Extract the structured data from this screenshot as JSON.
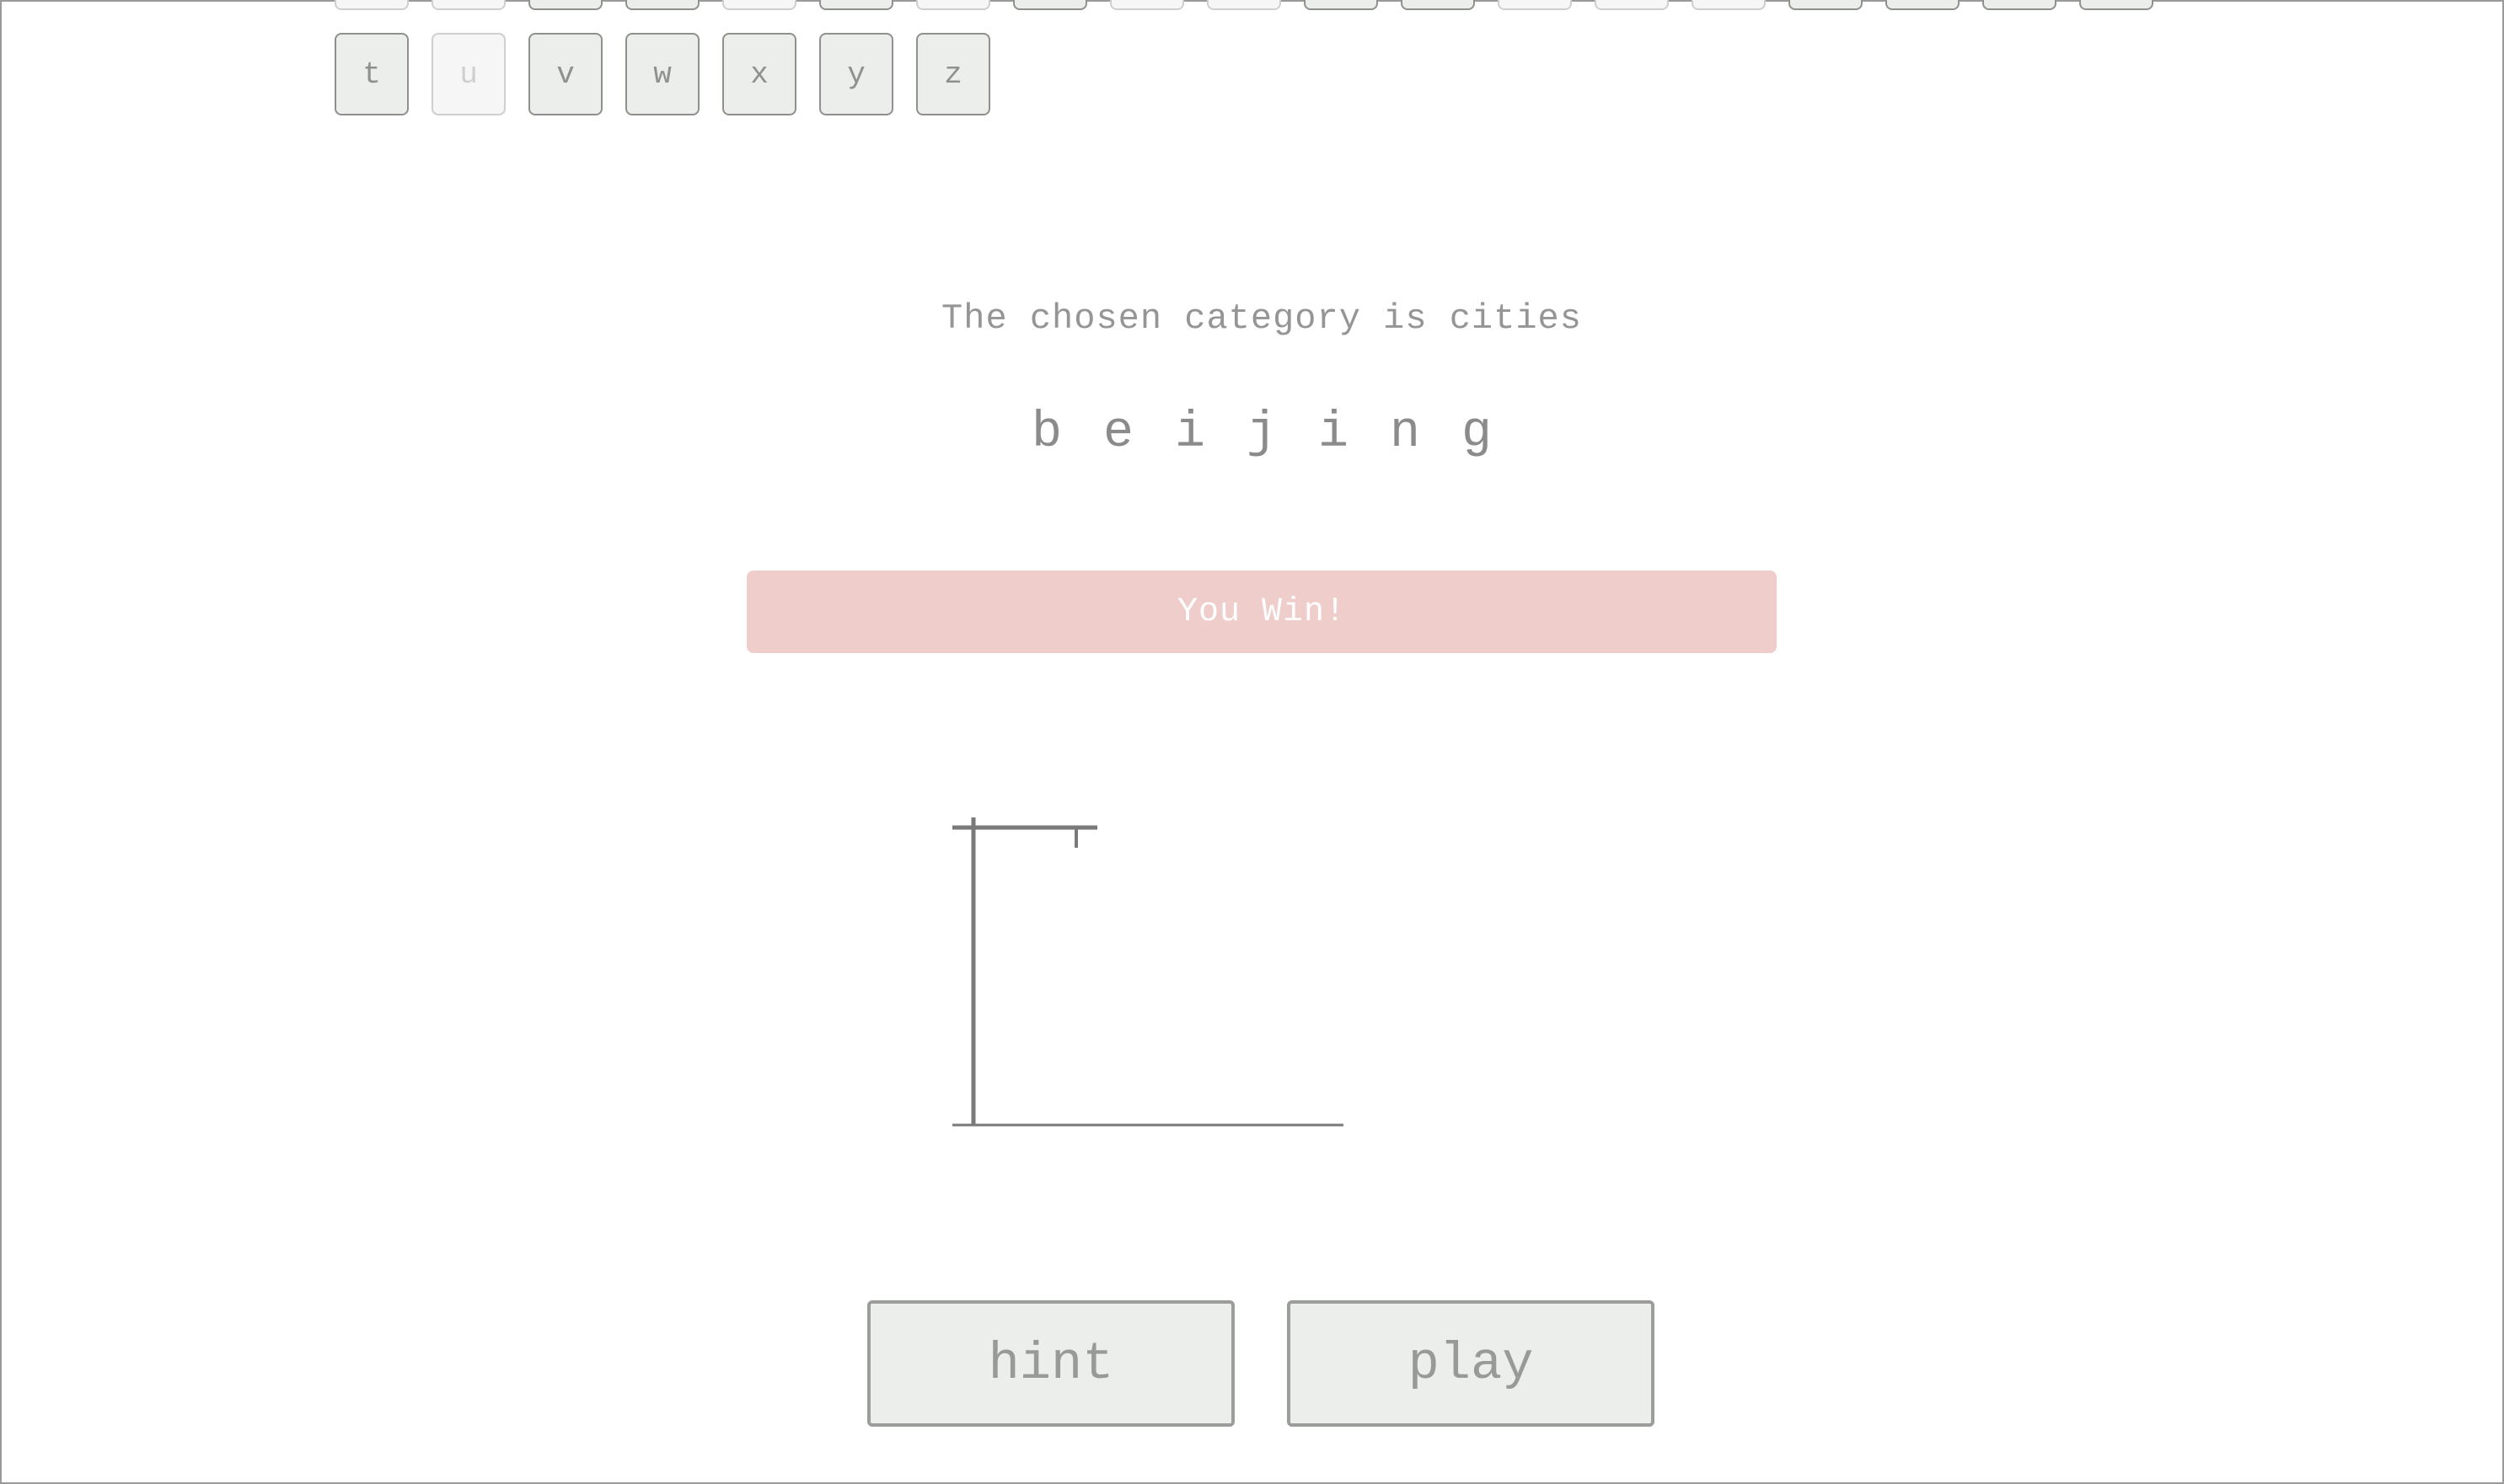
{
  "keyboard": {
    "bottom_row": [
      {
        "letter": "t",
        "used": false
      },
      {
        "letter": "u",
        "used": true
      },
      {
        "letter": "v",
        "used": false
      },
      {
        "letter": "w",
        "used": false
      },
      {
        "letter": "x",
        "used": false
      },
      {
        "letter": "y",
        "used": false
      },
      {
        "letter": "z",
        "used": false
      }
    ],
    "partial_row_used_pattern": [
      true,
      true,
      false,
      false,
      true,
      false,
      true,
      false,
      true,
      true,
      false,
      false,
      true,
      true,
      true,
      false,
      false,
      false,
      false
    ]
  },
  "category_text": "The chosen category is cities",
  "word_letters": [
    "b",
    "e",
    "i",
    "j",
    "i",
    "n",
    "g"
  ],
  "result_message": "You Win!",
  "buttons": {
    "hint_label": "hint",
    "play_label": "play"
  },
  "colors": {
    "key_background": "#eceeeb",
    "result_background": "#eecdcb",
    "text_gray": "#8f918e"
  }
}
